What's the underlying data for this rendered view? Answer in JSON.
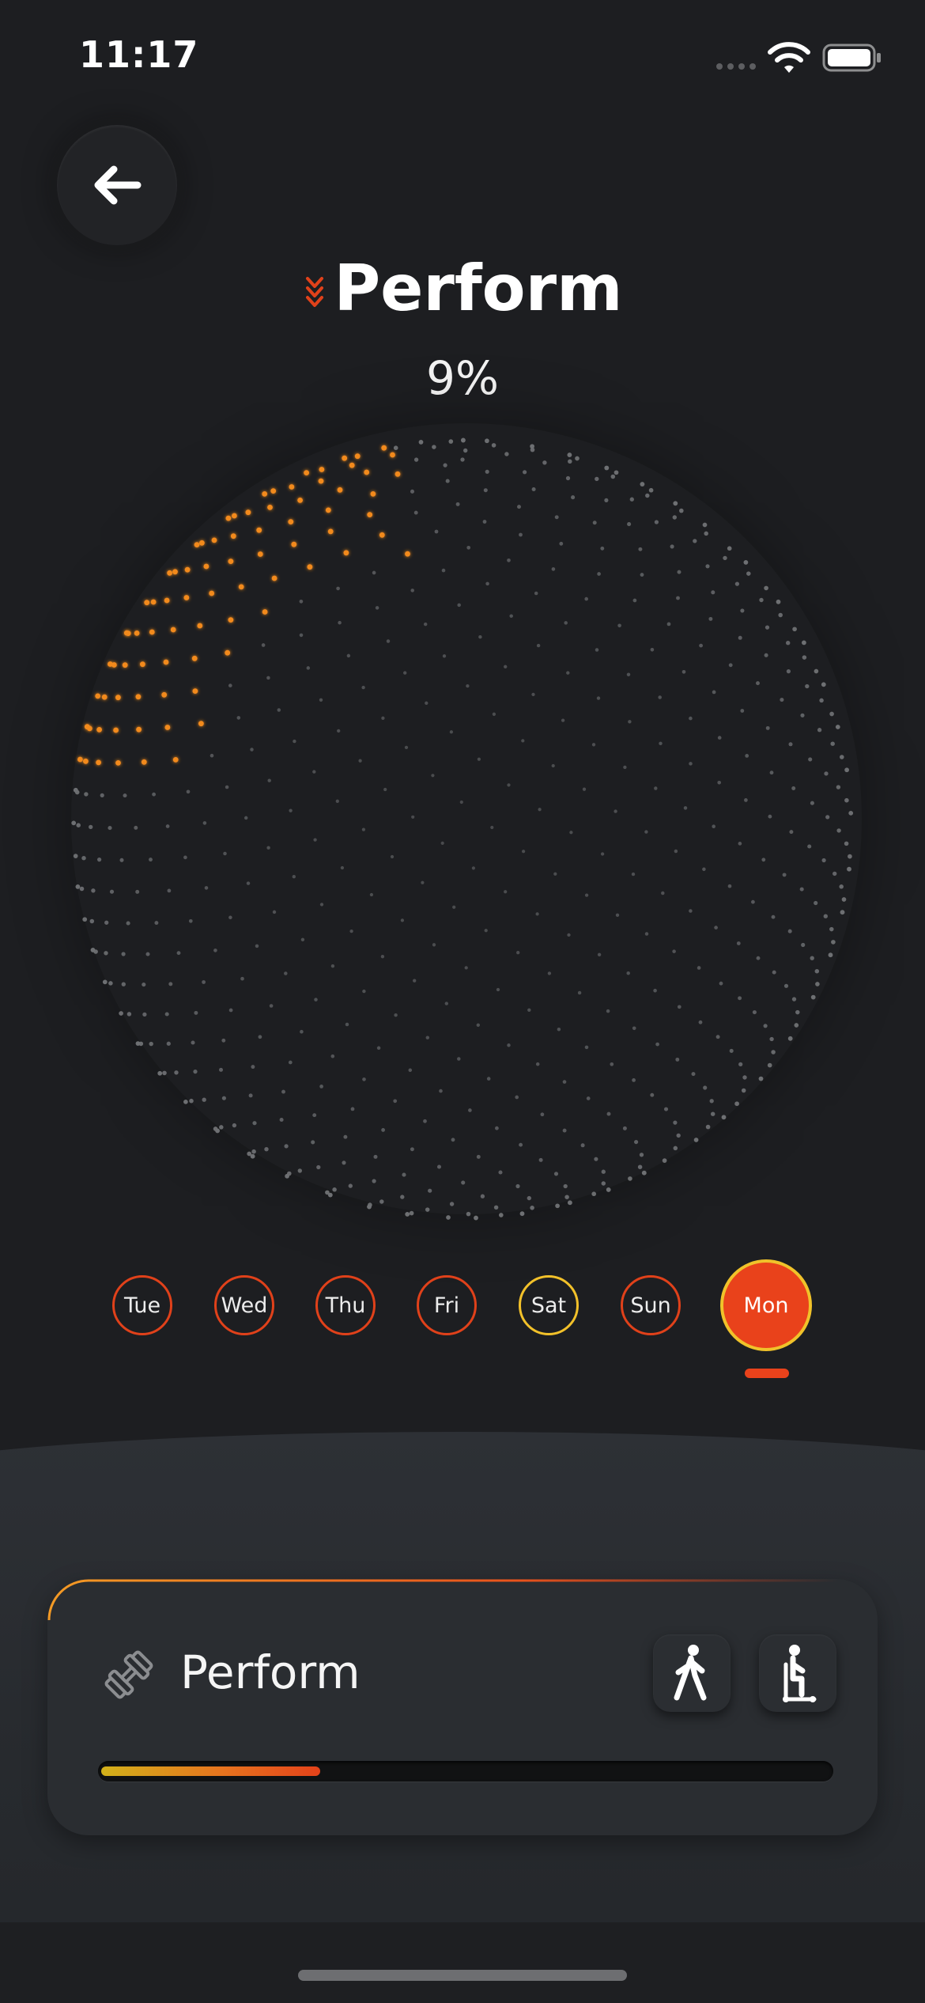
{
  "status_bar": {
    "time": "11:17"
  },
  "header": {
    "title": "Perform",
    "percent_label": "9%"
  },
  "progress": {
    "percent": 9
  },
  "days": [
    {
      "label": "Tue",
      "state": "default"
    },
    {
      "label": "Wed",
      "state": "default"
    },
    {
      "label": "Thu",
      "state": "default"
    },
    {
      "label": "Fri",
      "state": "default"
    },
    {
      "label": "Sat",
      "state": "highlight"
    },
    {
      "label": "Sun",
      "state": "default"
    },
    {
      "label": "Mon",
      "state": "selected"
    }
  ],
  "card": {
    "title": "Perform",
    "progress_fraction": 0.3,
    "actions": [
      "walk-icon",
      "scooter-icon"
    ]
  },
  "icons": {
    "back": "arrow-left-icon",
    "title": "double-chevron-down-icon",
    "card": "dumbbell-icon"
  },
  "colors": {
    "accent": "#e9421b",
    "highlight": "#f2c12a",
    "glow": "#f28a1d",
    "dot": "#6e7073",
    "background": "#1d1e21"
  }
}
